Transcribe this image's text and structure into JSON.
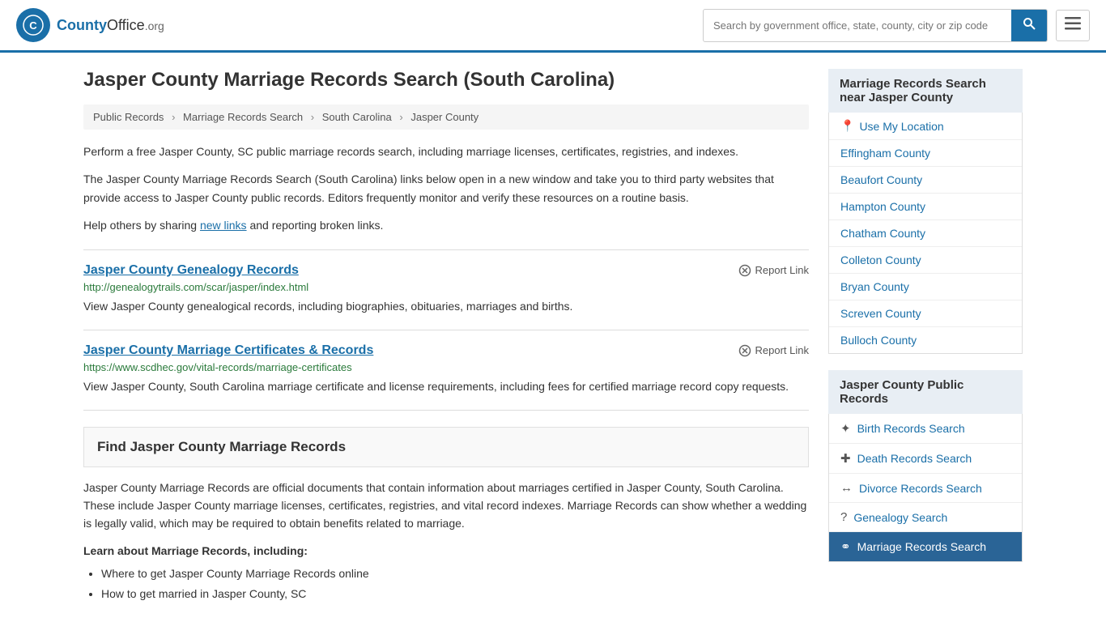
{
  "header": {
    "logo_text": "County",
    "logo_org": "Office",
    "logo_domain": ".org",
    "search_placeholder": "Search by government office, state, county, city or zip code"
  },
  "page": {
    "title": "Jasper County Marriage Records Search (South Carolina)"
  },
  "breadcrumb": {
    "items": [
      "Public Records",
      "Marriage Records Search",
      "South Carolina",
      "Jasper County"
    ]
  },
  "description": {
    "para1": "Perform a free Jasper County, SC public marriage records search, including marriage licenses, certificates, registries, and indexes.",
    "para2": "The Jasper County Marriage Records Search (South Carolina) links below open in a new window and take you to third party websites that provide access to Jasper County public records. Editors frequently monitor and verify these resources on a routine basis.",
    "para3_start": "Help others by sharing ",
    "para3_link": "new links",
    "para3_end": " and reporting broken links."
  },
  "records": [
    {
      "title": "Jasper County Genealogy Records",
      "url": "http://genealogytrails.com/scar/jasper/index.html",
      "desc": "View Jasper County genealogical records, including biographies, obituaries, marriages and births.",
      "report": "Report Link"
    },
    {
      "title": "Jasper County Marriage Certificates & Records",
      "url": "https://www.scdhec.gov/vital-records/marriage-certificates",
      "desc": "View Jasper County, South Carolina marriage certificate and license requirements, including fees for certified marriage record copy requests.",
      "report": "Report Link"
    }
  ],
  "find_section": {
    "heading": "Find Jasper County Marriage Records",
    "desc": "Jasper County Marriage Records are official documents that contain information about marriages certified in Jasper County, South Carolina. These include Jasper County marriage licenses, certificates, registries, and vital record indexes. Marriage Records can show whether a wedding is legally valid, which may be required to obtain benefits related to marriage.",
    "learn_title": "Learn about Marriage Records, including:",
    "learn_items": [
      "Where to get Jasper County Marriage Records online",
      "How to get married in Jasper County, SC"
    ]
  },
  "sidebar": {
    "nearby_heading": "Marriage Records Search near Jasper County",
    "use_location": "Use My Location",
    "nearby_counties": [
      "Effingham County",
      "Beaufort County",
      "Hampton County",
      "Chatham County",
      "Colleton County",
      "Bryan County",
      "Screven County",
      "Bulloch County"
    ],
    "public_records_heading": "Jasper County Public Records",
    "public_records": [
      {
        "icon": "🌟",
        "label": "Birth Records Search"
      },
      {
        "icon": "+",
        "label": "Death Records Search"
      },
      {
        "icon": "↔",
        "label": "Divorce Records Search"
      },
      {
        "icon": "?",
        "label": "Genealogy Search"
      },
      {
        "icon": "⚭",
        "label": "Marriage Records Search"
      }
    ]
  }
}
